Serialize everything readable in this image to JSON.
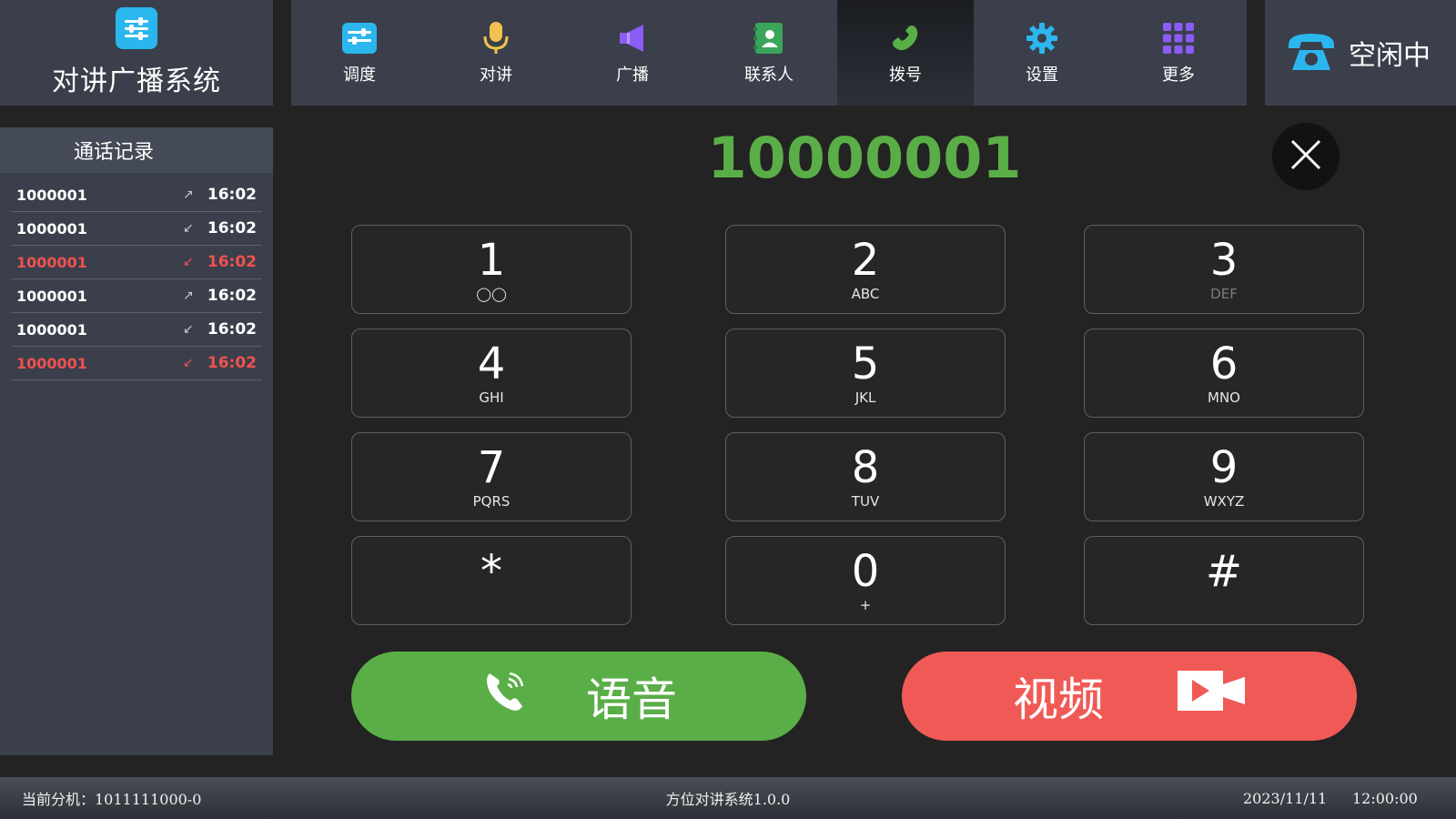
{
  "brand": {
    "title": "对讲广播系统",
    "icon": "sliders-icon",
    "color": "#2bb6ee"
  },
  "nav": {
    "items": [
      {
        "label": "调度",
        "icon": "sliders-icon",
        "color": "#2bb6ee"
      },
      {
        "label": "对讲",
        "icon": "microphone-icon",
        "color": "#f2c14e"
      },
      {
        "label": "广播",
        "icon": "speaker-icon",
        "color": "#8b5cf6"
      },
      {
        "label": "联系人",
        "icon": "contacts-icon",
        "color": "#3aa55a"
      },
      {
        "label": "拨号",
        "icon": "phone-handset-icon",
        "color": "#5aae47",
        "active": true
      },
      {
        "label": "设置",
        "icon": "gear-icon",
        "color": "#2bb6ee"
      },
      {
        "label": "更多",
        "icon": "grid-icon",
        "color": "#8b5cf6"
      }
    ]
  },
  "status": {
    "label": "空闲中",
    "icon": "telephone-icon",
    "color": "#2bb6ee"
  },
  "call_log": {
    "title": "通话记录",
    "rows": [
      {
        "number": "1000001",
        "direction": "outgoing",
        "time": "16:02",
        "missed": false
      },
      {
        "number": "1000001",
        "direction": "incoming",
        "time": "16:02",
        "missed": false
      },
      {
        "number": "1000001",
        "direction": "incoming",
        "time": "16:02",
        "missed": true
      },
      {
        "number": "1000001",
        "direction": "outgoing",
        "time": "16:02",
        "missed": false
      },
      {
        "number": "1000001",
        "direction": "incoming",
        "time": "16:02",
        "missed": false
      },
      {
        "number": "1000001",
        "direction": "incoming",
        "time": "16:02",
        "missed": true
      }
    ],
    "missed_color": "#f0524f"
  },
  "dialer": {
    "number": "10000001",
    "number_color": "#5aae47",
    "keys": [
      {
        "digit": "1",
        "sub": "◯◯"
      },
      {
        "digit": "2",
        "sub": "ABC"
      },
      {
        "digit": "3",
        "sub": "DEF"
      },
      {
        "digit": "4",
        "sub": "GHI"
      },
      {
        "digit": "5",
        "sub": "JKL"
      },
      {
        "digit": "6",
        "sub": "MNO"
      },
      {
        "digit": "7",
        "sub": "PQRS"
      },
      {
        "digit": "8",
        "sub": "TUV"
      },
      {
        "digit": "9",
        "sub": "WXYZ"
      },
      {
        "digit": "*",
        "sub": ""
      },
      {
        "digit": "0",
        "sub": "+"
      },
      {
        "digit": "#",
        "sub": ""
      }
    ]
  },
  "actions": {
    "voice_label": "语音",
    "voice_color": "#5aae47",
    "video_label": "视频",
    "video_color": "#f05a56"
  },
  "footer": {
    "extension": "当前分机：1011111000-0",
    "system": "方位对讲系统1.0.0",
    "date": "2023/11/11",
    "time": "12:00:00"
  }
}
